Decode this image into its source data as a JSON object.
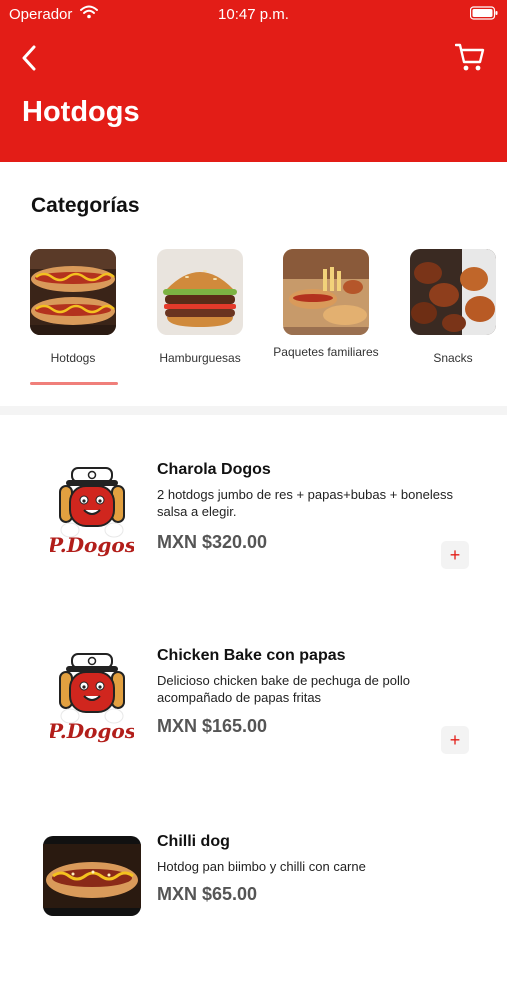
{
  "status_bar": {
    "carrier": "Operador",
    "time": "10:47 p.m."
  },
  "header": {
    "title": "Hotdogs",
    "back_icon": "chevron-left-icon",
    "cart_icon": "shopping-cart-icon",
    "background_color": "#e31d17"
  },
  "categories": {
    "title": "Categorías",
    "items": [
      {
        "label": "Hotdogs",
        "selected": true
      },
      {
        "label": "Hamburguesas",
        "selected": false
      },
      {
        "label": "Paquetes familiares",
        "selected": false
      },
      {
        "label": "Snacks",
        "selected": false
      }
    ]
  },
  "products": [
    {
      "name": "Charola Dogos",
      "description": "2 hotdogs jumbo de res + papas+bubas + boneless salsa a elegir.",
      "price": "MXN $320.00",
      "image": "p-dogos-logo",
      "add_label": "+"
    },
    {
      "name": "Chicken Bake con papas",
      "description": "Delicioso chicken bake de pechuga de pollo acompañado de papas fritas",
      "price": "MXN $165.00",
      "image": "p-dogos-logo",
      "add_label": "+"
    },
    {
      "name": "Chilli dog",
      "description": "Hotdog pan biimbo y chilli con carne",
      "price": "MXN $65.00",
      "image": "hotdog-photo"
    }
  ],
  "logo_text": "P.Dogos",
  "colors": {
    "accent": "#e31d17",
    "indicator": "#f07f7a",
    "price": "#555555"
  }
}
